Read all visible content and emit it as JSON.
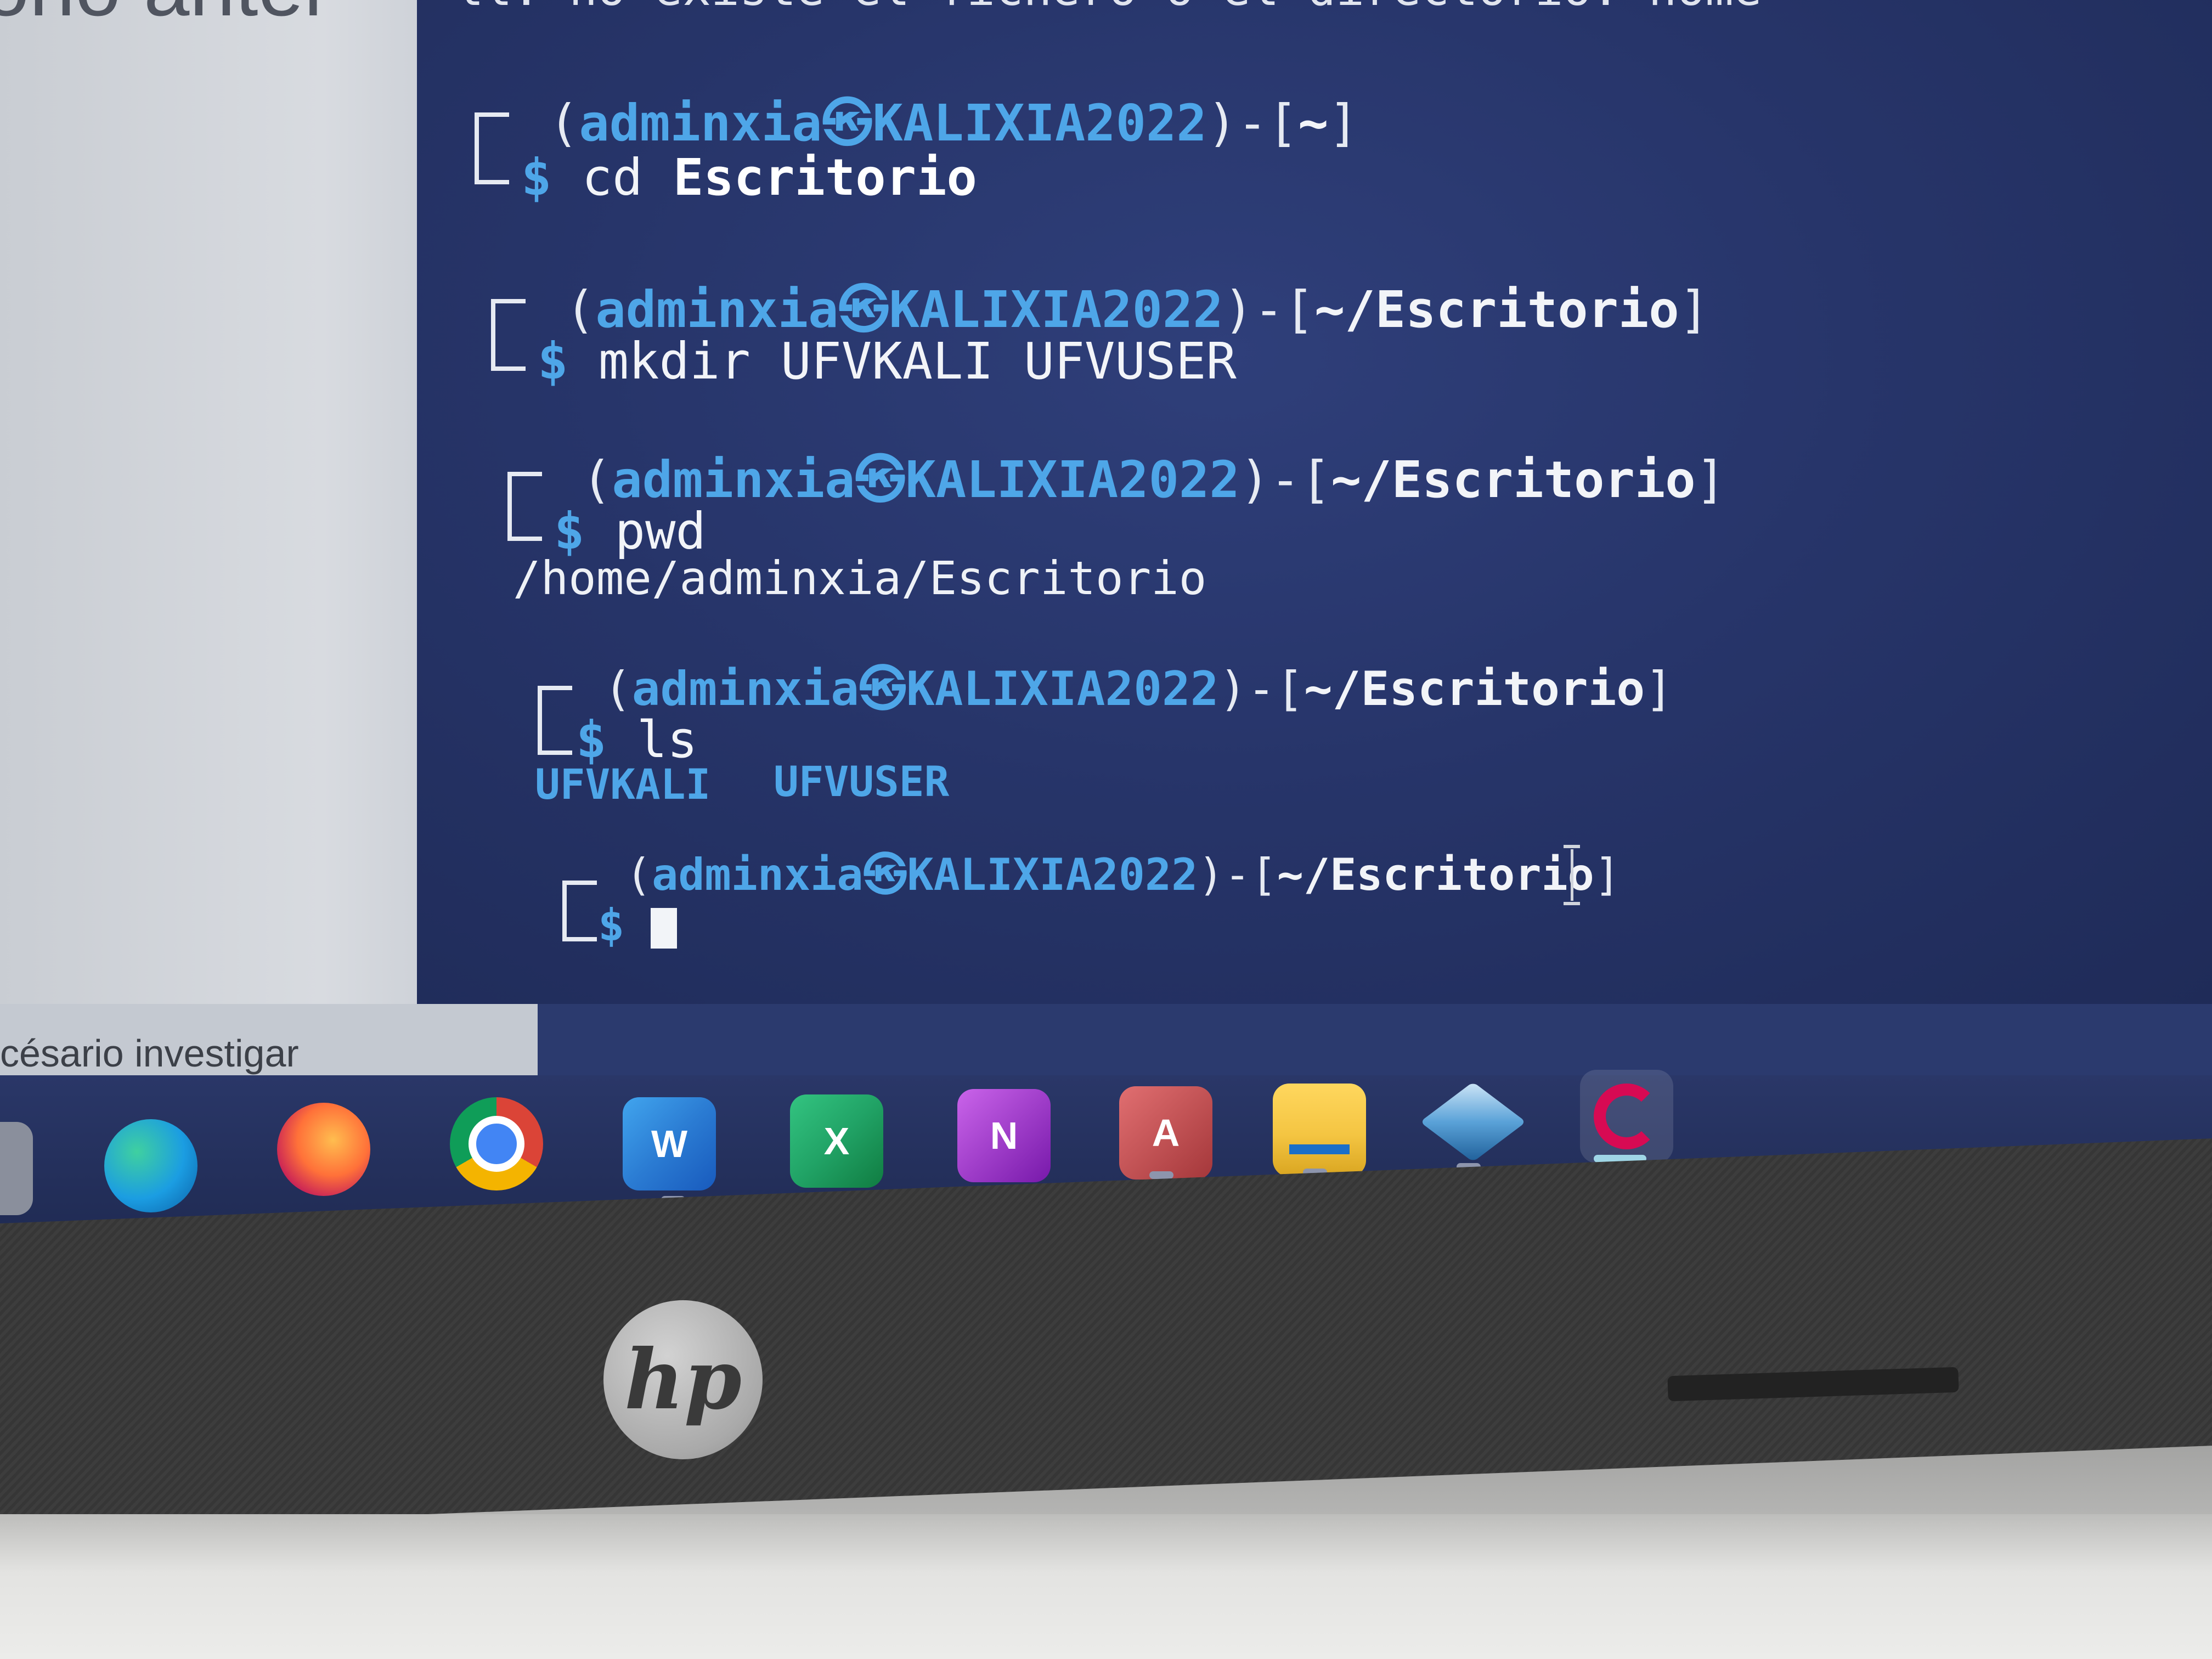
{
  "document": {
    "heading_fragment": "ono anter",
    "caption_fragment": "césario investigar"
  },
  "terminal": {
    "top_cut_line": "ll: no existe el fichero o el directorio: home",
    "blocks": [
      {
        "user": "adminxia",
        "at": "㉿",
        "host": "KALIXIA2022",
        "path": "~",
        "command": "cd",
        "argument": "Escritorio",
        "output": ""
      },
      {
        "user": "adminxia",
        "at": "㉿",
        "host": "KALIXIA2022",
        "path": "~/Escritorio",
        "command": "mkdir UFVKALI UFVUSER",
        "output": ""
      },
      {
        "user": "adminxia",
        "at": "㉿",
        "host": "KALIXIA2022",
        "path": "~/Escritorio",
        "command": "pwd",
        "output": "/home/adminxia/Escritorio"
      },
      {
        "user": "adminxia",
        "at": "㉿",
        "host": "KALIXIA2022",
        "path": "~/Escritorio",
        "command": "ls",
        "output_dirs": [
          "UFVKALI",
          "UFVUSER"
        ]
      },
      {
        "user": "adminxia",
        "at": "㉿",
        "host": "KALIXIA2022",
        "path": "~/Escritorio",
        "command": ""
      }
    ],
    "prompt_symbol": "$",
    "prompt_open": "(",
    "prompt_mid": ")-[",
    "prompt_close": "]"
  },
  "taskbar": {
    "icons": [
      {
        "name": "edge-icon",
        "letter": "",
        "color": "#1b9de2"
      },
      {
        "name": "firefox-icon",
        "letter": "",
        "color": "#e66000"
      },
      {
        "name": "chrome-icon",
        "letter": "",
        "color": "#db4437"
      },
      {
        "name": "word-icon",
        "letter": "W",
        "color": "#2b5fb4"
      },
      {
        "name": "excel-icon",
        "letter": "X",
        "color": "#1e7145"
      },
      {
        "name": "onenote-icon",
        "letter": "N",
        "color": "#7719aa"
      },
      {
        "name": "access-icon",
        "letter": "A",
        "color": "#a4373a"
      },
      {
        "name": "file-explorer-icon",
        "letter": "",
        "color": "#f4c542"
      },
      {
        "name": "virtualbox-icon",
        "letter": "",
        "color": "#3a86c8"
      },
      {
        "name": "debian-installer-icon",
        "letter": "",
        "color": "#d70a53"
      }
    ]
  },
  "device": {
    "brand": "hp"
  }
}
